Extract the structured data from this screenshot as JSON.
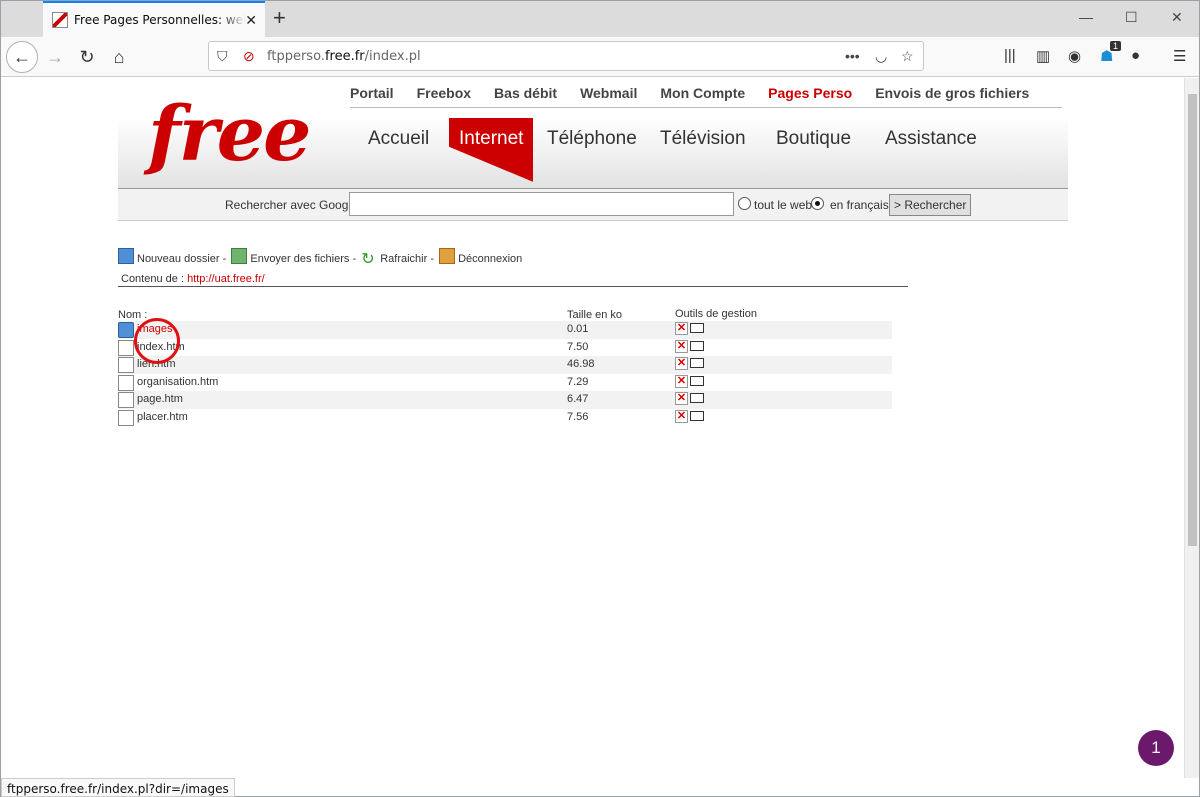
{
  "browser": {
    "tab_title": "Free Pages Personnelles: web ftp",
    "url_domain_prefix": "ftpperso.",
    "url_domain": "free.fr",
    "url_path": "/index.pl",
    "notification_count": "1",
    "status_text": "ftpperso.free.fr/index.pl?dir=/images"
  },
  "header": {
    "logo_text": "free",
    "top_links": [
      "Portail",
      "Freebox",
      "Bas débit",
      "Webmail",
      "Mon Compte",
      "Pages Perso",
      "Envois de gros fichiers"
    ],
    "active_top_link": "Pages Perso",
    "main_nav": [
      "Accueil",
      "Internet",
      "Téléphone",
      "Télévision",
      "Boutique",
      "Assistance"
    ],
    "active_main_nav": "Internet",
    "brand_color": "#cc0000"
  },
  "search": {
    "label": "Rechercher avec Google",
    "value": "",
    "option_web": "tout le web",
    "option_fr": "en français",
    "button": "> Rechercher"
  },
  "toolbar": {
    "new_folder": "Nouveau dossier",
    "upload": "Envoyer des fichiers",
    "refresh": "Rafraichir",
    "logout": "Déconnexion",
    "content_label": "Contenu de :",
    "content_url": "http://uat.free.fr/"
  },
  "files": {
    "headers": {
      "name": "Nom :",
      "size": "Taille en ko",
      "tools": "Outils de gestion"
    },
    "rows": [
      {
        "name": "images",
        "size": "0.01",
        "type": "folder"
      },
      {
        "name": "index.htm",
        "size": "7.50",
        "type": "file"
      },
      {
        "name": "lien.htm",
        "size": "46.98",
        "type": "file"
      },
      {
        "name": "organisation.htm",
        "size": "7.29",
        "type": "file"
      },
      {
        "name": "page.htm",
        "size": "6.47",
        "type": "file"
      },
      {
        "name": "placer.htm",
        "size": "7.56",
        "type": "file"
      }
    ]
  },
  "fab_label": "1"
}
